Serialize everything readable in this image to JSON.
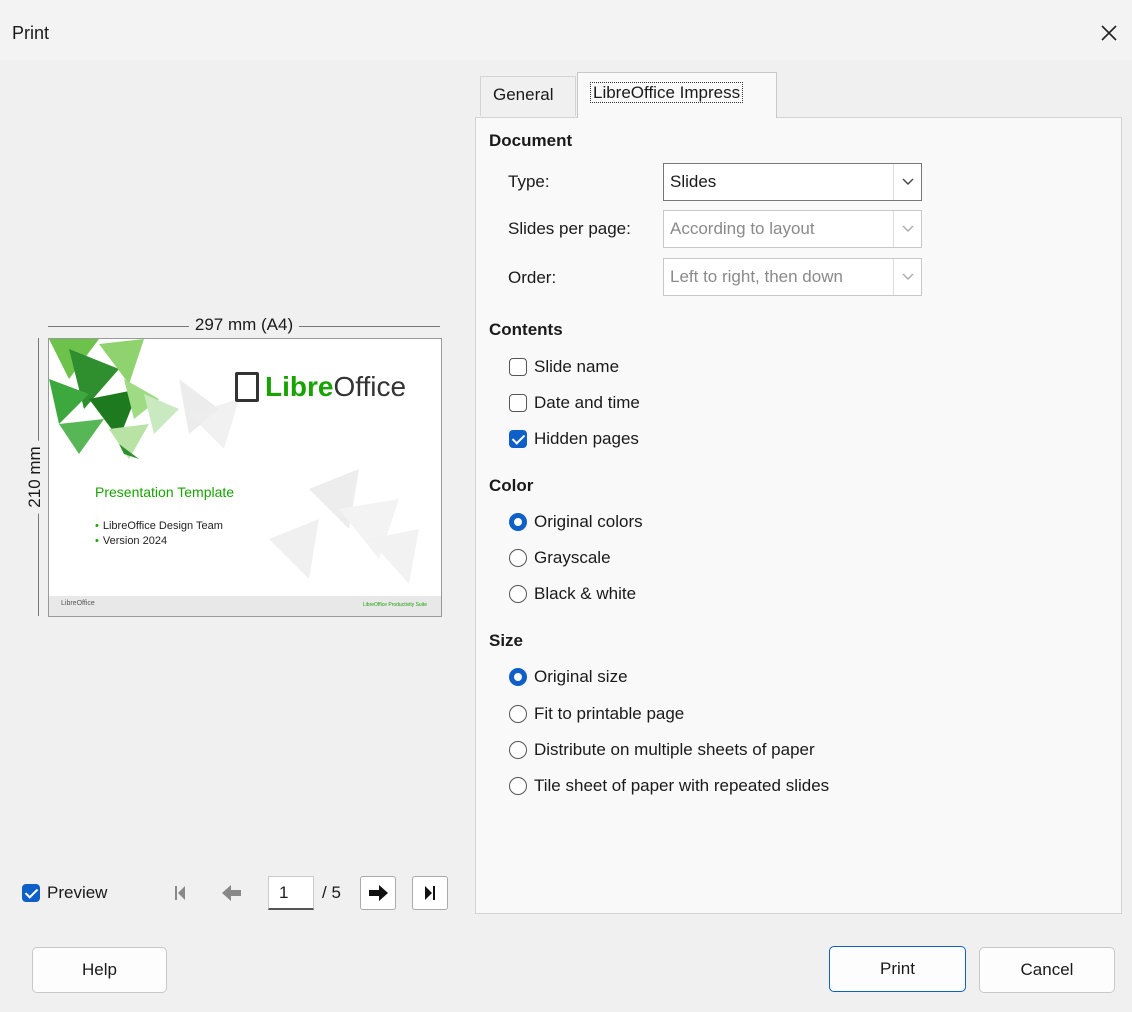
{
  "window": {
    "title": "Print"
  },
  "preview": {
    "width_label": "297 mm (A4)",
    "height_label": "210 mm",
    "slide": {
      "logo_prefix": "Libre",
      "logo_suffix": "Office",
      "title": "Presentation Template",
      "bullets": [
        "LibreOffice Design Team",
        "Version 2024"
      ],
      "footer_left": "LibreOffice",
      "footer_right": "LibreOffice Productivity Suite"
    },
    "checkbox_label": "Preview",
    "preview_checked": true,
    "current_page": "1",
    "total_pages": "/ 5"
  },
  "tabs": [
    {
      "label": "General",
      "active": false
    },
    {
      "label": "LibreOffice Impress",
      "active": true
    }
  ],
  "document": {
    "heading": "Document",
    "type_label": "Type:",
    "type_value": "Slides",
    "slides_per_page_label": "Slides per page:",
    "slides_per_page_value": "According to layout",
    "order_label": "Order:",
    "order_value": "Left to right, then down"
  },
  "contents": {
    "heading": "Contents",
    "options": [
      {
        "label": "Slide name",
        "checked": false
      },
      {
        "label": "Date and time",
        "checked": false
      },
      {
        "label": "Hidden pages",
        "checked": true
      }
    ]
  },
  "color": {
    "heading": "Color",
    "options": [
      {
        "label": "Original colors",
        "selected": true
      },
      {
        "label": "Grayscale",
        "selected": false
      },
      {
        "label": "Black & white",
        "selected": false
      }
    ]
  },
  "size": {
    "heading": "Size",
    "options": [
      {
        "label": "Original size",
        "selected": true
      },
      {
        "label": "Fit to printable page",
        "selected": false
      },
      {
        "label": "Distribute on multiple sheets of paper",
        "selected": false
      },
      {
        "label": "Tile sheet of paper with repeated slides",
        "selected": false
      }
    ]
  },
  "buttons": {
    "help": "Help",
    "print": "Print",
    "cancel": "Cancel"
  },
  "colors": {
    "accent": "#0f5fc8",
    "brand_green": "#18a303"
  }
}
